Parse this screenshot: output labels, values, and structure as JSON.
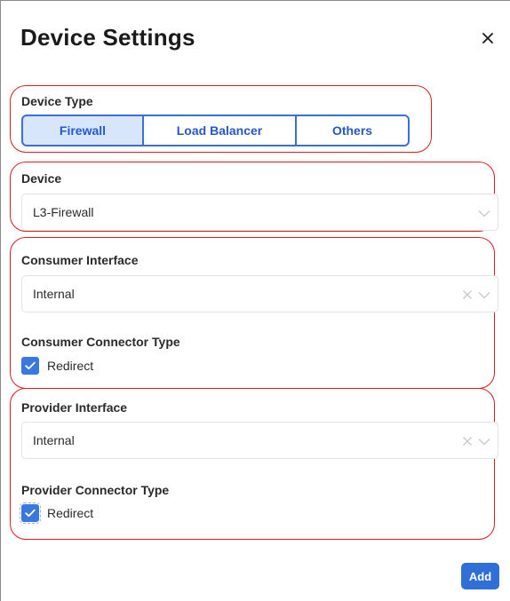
{
  "dialog": {
    "title": "Device Settings",
    "close_label": "×"
  },
  "device_type": {
    "label": "Device Type",
    "options": [
      "Firewall",
      "Load Balancer",
      "Others"
    ],
    "selected": "Firewall"
  },
  "device": {
    "label": "Device",
    "value": "L3-Firewall"
  },
  "consumer": {
    "interface_label": "Consumer Interface",
    "interface_value": "Internal",
    "connector_label": "Consumer Connector Type",
    "connector_option": "Redirect",
    "connector_checked": true
  },
  "provider": {
    "interface_label": "Provider Interface",
    "interface_value": "Internal",
    "connector_label": "Provider Connector Type",
    "connector_option": "Redirect",
    "connector_checked": true
  },
  "actions": {
    "add_label": "Add"
  },
  "colors": {
    "accent": "#2f6fd6",
    "selected_segment_bg": "#d7e6fb",
    "highlight_outline": "#d81d1d"
  },
  "icons": {
    "close": "close-icon",
    "dropdown": "chevron-down-icon",
    "clear": "clear-x-icon",
    "check": "checkmark-icon"
  }
}
